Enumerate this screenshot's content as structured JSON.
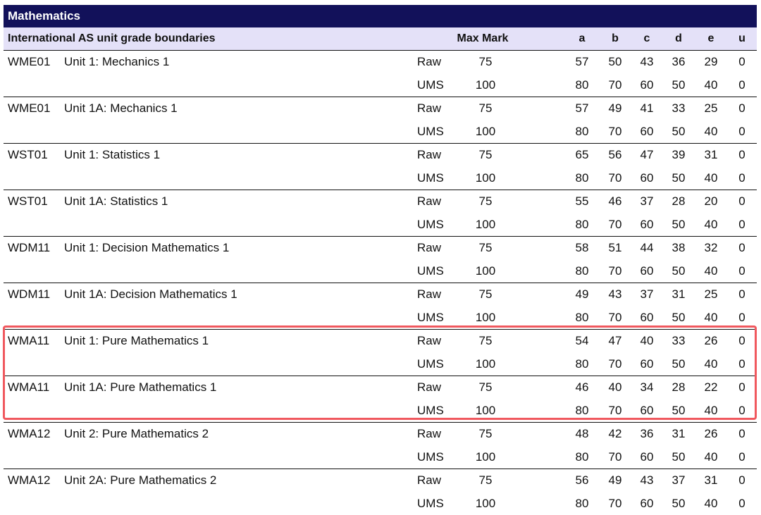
{
  "title": "Mathematics",
  "header": {
    "label": "International AS unit grade boundaries",
    "max_mark": "Max Mark",
    "grades": [
      "a",
      "b",
      "c",
      "d",
      "e",
      "u"
    ]
  },
  "units": [
    {
      "code": "WME01",
      "name": "Unit 1: Mechanics 1",
      "raw": {
        "type": "Raw",
        "max": "75",
        "grades": [
          "57",
          "50",
          "43",
          "36",
          "29",
          "0"
        ]
      },
      "ums": {
        "type": "UMS",
        "max": "100",
        "grades": [
          "80",
          "70",
          "60",
          "50",
          "40",
          "0"
        ]
      }
    },
    {
      "code": "WME01",
      "name": "Unit 1A: Mechanics 1",
      "raw": {
        "type": "Raw",
        "max": "75",
        "grades": [
          "57",
          "49",
          "41",
          "33",
          "25",
          "0"
        ]
      },
      "ums": {
        "type": "UMS",
        "max": "100",
        "grades": [
          "80",
          "70",
          "60",
          "50",
          "40",
          "0"
        ]
      }
    },
    {
      "code": "WST01",
      "name": "Unit 1: Statistics 1",
      "raw": {
        "type": "Raw",
        "max": "75",
        "grades": [
          "65",
          "56",
          "47",
          "39",
          "31",
          "0"
        ]
      },
      "ums": {
        "type": "UMS",
        "max": "100",
        "grades": [
          "80",
          "70",
          "60",
          "50",
          "40",
          "0"
        ]
      }
    },
    {
      "code": "WST01",
      "name": "Unit 1A: Statistics 1",
      "raw": {
        "type": "Raw",
        "max": "75",
        "grades": [
          "55",
          "46",
          "37",
          "28",
          "20",
          "0"
        ]
      },
      "ums": {
        "type": "UMS",
        "max": "100",
        "grades": [
          "80",
          "70",
          "60",
          "50",
          "40",
          "0"
        ]
      }
    },
    {
      "code": "WDM11",
      "name": "Unit 1: Decision Mathematics 1",
      "raw": {
        "type": "Raw",
        "max": "75",
        "grades": [
          "58",
          "51",
          "44",
          "38",
          "32",
          "0"
        ]
      },
      "ums": {
        "type": "UMS",
        "max": "100",
        "grades": [
          "80",
          "70",
          "60",
          "50",
          "40",
          "0"
        ]
      }
    },
    {
      "code": "WDM11",
      "name": "Unit 1A: Decision Mathematics 1",
      "raw": {
        "type": "Raw",
        "max": "75",
        "grades": [
          "49",
          "43",
          "37",
          "31",
          "25",
          "0"
        ]
      },
      "ums": {
        "type": "UMS",
        "max": "100",
        "grades": [
          "80",
          "70",
          "60",
          "50",
          "40",
          "0"
        ]
      }
    },
    {
      "code": "WMA11",
      "name": "Unit 1: Pure Mathematics 1",
      "raw": {
        "type": "Raw",
        "max": "75",
        "grades": [
          "54",
          "47",
          "40",
          "33",
          "26",
          "0"
        ]
      },
      "ums": {
        "type": "UMS",
        "max": "100",
        "grades": [
          "80",
          "70",
          "60",
          "50",
          "40",
          "0"
        ]
      }
    },
    {
      "code": "WMA11",
      "name": "Unit 1A: Pure Mathematics 1",
      "raw": {
        "type": "Raw",
        "max": "75",
        "grades": [
          "46",
          "40",
          "34",
          "28",
          "22",
          "0"
        ]
      },
      "ums": {
        "type": "UMS",
        "max": "100",
        "grades": [
          "80",
          "70",
          "60",
          "50",
          "40",
          "0"
        ]
      }
    },
    {
      "code": "WMA12",
      "name": "Unit 2: Pure Mathematics 2",
      "raw": {
        "type": "Raw",
        "max": "75",
        "grades": [
          "48",
          "42",
          "36",
          "31",
          "26",
          "0"
        ]
      },
      "ums": {
        "type": "UMS",
        "max": "100",
        "grades": [
          "80",
          "70",
          "60",
          "50",
          "40",
          "0"
        ]
      }
    },
    {
      "code": "WMA12",
      "name": "Unit 2A: Pure Mathematics 2",
      "raw": {
        "type": "Raw",
        "max": "75",
        "grades": [
          "56",
          "49",
          "43",
          "37",
          "31",
          "0"
        ]
      },
      "ums": {
        "type": "UMS",
        "max": "100",
        "grades": [
          "80",
          "70",
          "60",
          "50",
          "40",
          "0"
        ]
      }
    }
  ],
  "colors": {
    "title_bg": "#12115a",
    "header_bg": "#e4e1f8",
    "highlight": "#f0585e"
  }
}
